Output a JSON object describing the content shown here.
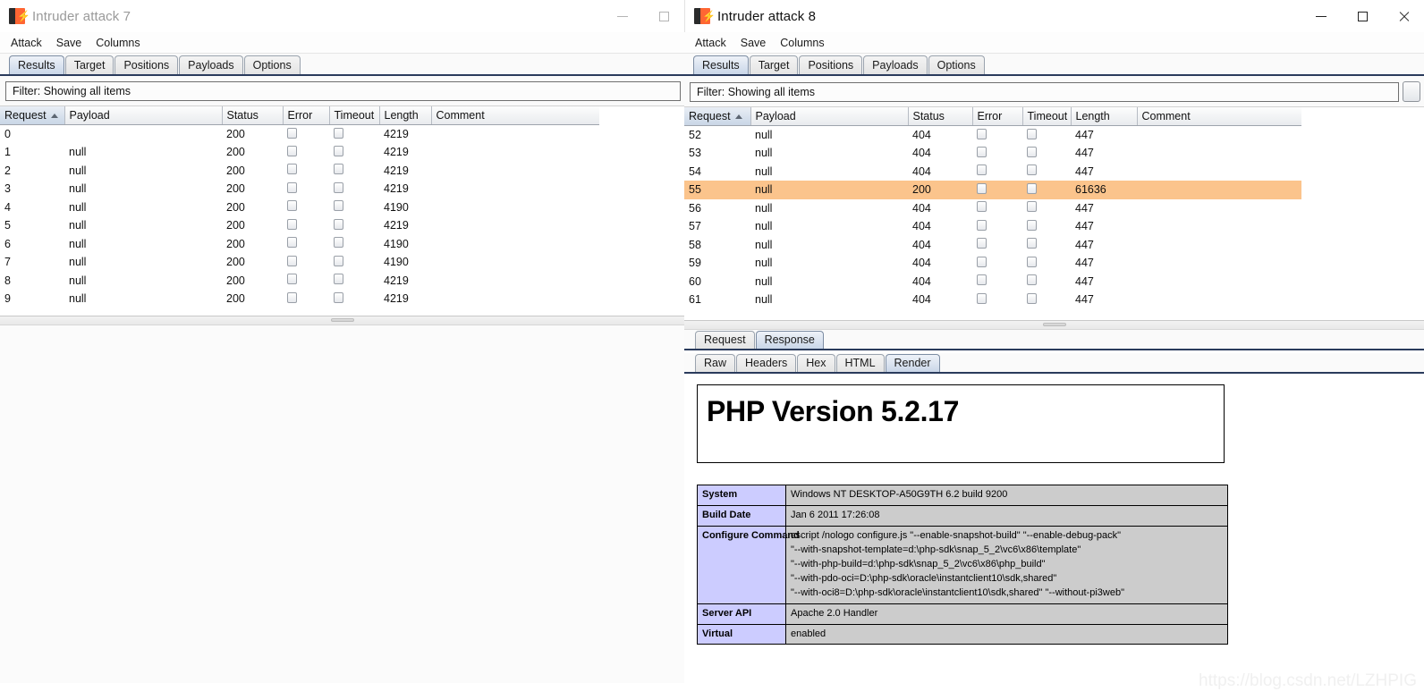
{
  "windows": {
    "left": {
      "title": "Intruder attack 7",
      "icon": "burp-icon",
      "active": false,
      "controls": {
        "minimize": "minimize-icon",
        "maximize": "maximize-icon"
      },
      "menu": [
        "Attack",
        "Save",
        "Columns"
      ],
      "tabs": [
        {
          "label": "Results",
          "active": true
        },
        {
          "label": "Target",
          "active": false
        },
        {
          "label": "Positions",
          "active": false
        },
        {
          "label": "Payloads",
          "active": false
        },
        {
          "label": "Options",
          "active": false
        }
      ],
      "filter": "Filter: Showing all items",
      "table": {
        "columns": [
          "Request",
          "Payload",
          "Status",
          "Error",
          "Timeout",
          "Length",
          "Comment"
        ],
        "sort_column": "Request",
        "sort_direction": "ascending",
        "rows": [
          {
            "request": "0",
            "payload": "",
            "status": "200",
            "error": false,
            "timeout": false,
            "length": "4219",
            "comment": ""
          },
          {
            "request": "1",
            "payload": "null",
            "status": "200",
            "error": false,
            "timeout": false,
            "length": "4219",
            "comment": ""
          },
          {
            "request": "2",
            "payload": "null",
            "status": "200",
            "error": false,
            "timeout": false,
            "length": "4219",
            "comment": ""
          },
          {
            "request": "3",
            "payload": "null",
            "status": "200",
            "error": false,
            "timeout": false,
            "length": "4219",
            "comment": ""
          },
          {
            "request": "4",
            "payload": "null",
            "status": "200",
            "error": false,
            "timeout": false,
            "length": "4190",
            "comment": ""
          },
          {
            "request": "5",
            "payload": "null",
            "status": "200",
            "error": false,
            "timeout": false,
            "length": "4219",
            "comment": ""
          },
          {
            "request": "6",
            "payload": "null",
            "status": "200",
            "error": false,
            "timeout": false,
            "length": "4190",
            "comment": ""
          },
          {
            "request": "7",
            "payload": "null",
            "status": "200",
            "error": false,
            "timeout": false,
            "length": "4190",
            "comment": ""
          },
          {
            "request": "8",
            "payload": "null",
            "status": "200",
            "error": false,
            "timeout": false,
            "length": "4219",
            "comment": ""
          },
          {
            "request": "9",
            "payload": "null",
            "status": "200",
            "error": false,
            "timeout": false,
            "length": "4219",
            "comment": ""
          }
        ]
      }
    },
    "right": {
      "title": "Intruder attack 8",
      "icon": "burp-icon",
      "active": true,
      "controls": {
        "minimize": "minimize-icon",
        "maximize": "maximize-icon",
        "close": "close-icon"
      },
      "menu": [
        "Attack",
        "Save",
        "Columns"
      ],
      "tabs": [
        {
          "label": "Results",
          "active": true
        },
        {
          "label": "Target",
          "active": false
        },
        {
          "label": "Positions",
          "active": false
        },
        {
          "label": "Payloads",
          "active": false
        },
        {
          "label": "Options",
          "active": false
        }
      ],
      "filter": "Filter: Showing all items",
      "table": {
        "columns": [
          "Request",
          "Payload",
          "Status",
          "Error",
          "Timeout",
          "Length",
          "Comment"
        ],
        "sort_column": "Request",
        "sort_direction": "ascending",
        "selected_request": "55",
        "rows": [
          {
            "request": "52",
            "payload": "null",
            "status": "404",
            "error": false,
            "timeout": false,
            "length": "447",
            "comment": "",
            "selected": false
          },
          {
            "request": "53",
            "payload": "null",
            "status": "404",
            "error": false,
            "timeout": false,
            "length": "447",
            "comment": "",
            "selected": false
          },
          {
            "request": "54",
            "payload": "null",
            "status": "404",
            "error": false,
            "timeout": false,
            "length": "447",
            "comment": "",
            "selected": false
          },
          {
            "request": "55",
            "payload": "null",
            "status": "200",
            "error": false,
            "timeout": false,
            "length": "61636",
            "comment": "",
            "selected": true
          },
          {
            "request": "56",
            "payload": "null",
            "status": "404",
            "error": false,
            "timeout": false,
            "length": "447",
            "comment": "",
            "selected": false
          },
          {
            "request": "57",
            "payload": "null",
            "status": "404",
            "error": false,
            "timeout": false,
            "length": "447",
            "comment": "",
            "selected": false
          },
          {
            "request": "58",
            "payload": "null",
            "status": "404",
            "error": false,
            "timeout": false,
            "length": "447",
            "comment": "",
            "selected": false
          },
          {
            "request": "59",
            "payload": "null",
            "status": "404",
            "error": false,
            "timeout": false,
            "length": "447",
            "comment": "",
            "selected": false
          },
          {
            "request": "60",
            "payload": "null",
            "status": "404",
            "error": false,
            "timeout": false,
            "length": "447",
            "comment": "",
            "selected": false
          },
          {
            "request": "61",
            "payload": "null",
            "status": "404",
            "error": false,
            "timeout": false,
            "length": "447",
            "comment": "",
            "selected": false
          }
        ]
      },
      "message_tabs": [
        {
          "label": "Request",
          "active": false
        },
        {
          "label": "Response",
          "active": true
        }
      ],
      "view_tabs": [
        {
          "label": "Raw",
          "active": false
        },
        {
          "label": "Headers",
          "active": false
        },
        {
          "label": "Hex",
          "active": false
        },
        {
          "label": "HTML",
          "active": false
        },
        {
          "label": "Render",
          "active": true
        }
      ],
      "render": {
        "heading": "PHP Version 5.2.17",
        "info_rows": [
          {
            "key": "System",
            "values": [
              "Windows NT DESKTOP-A50G9TH 6.2 build 9200"
            ]
          },
          {
            "key": "Build Date",
            "values": [
              "Jan 6 2011 17:26:08"
            ]
          },
          {
            "key": "Configure Command",
            "values": [
              "cscript /nologo configure.js \"--enable-snapshot-build\" \"--enable-debug-pack\"",
              "\"--with-snapshot-template=d:\\php-sdk\\snap_5_2\\vc6\\x86\\template\"",
              "\"--with-php-build=d:\\php-sdk\\snap_5_2\\vc6\\x86\\php_build\"",
              "\"--with-pdo-oci=D:\\php-sdk\\oracle\\instantclient10\\sdk,shared\"",
              "\"--with-oci8=D:\\php-sdk\\oracle\\instantclient10\\sdk,shared\" \"--without-pi3web\""
            ]
          },
          {
            "key": "Server API",
            "values": [
              "Apache 2.0 Handler"
            ]
          },
          {
            "key": "Virtual",
            "values": [
              "enabled"
            ]
          }
        ]
      }
    }
  },
  "watermark": "https://blog.csdn.net/LZHPIG",
  "colors": {
    "selected_row": "#fbc48c",
    "tab_active": "#c9d6e8",
    "tab_underline": "#2a3b5c",
    "phpinfo_key_bg": "#ccccff",
    "phpinfo_value_bg": "#cccccc",
    "brand_orange": "#ff6633"
  }
}
